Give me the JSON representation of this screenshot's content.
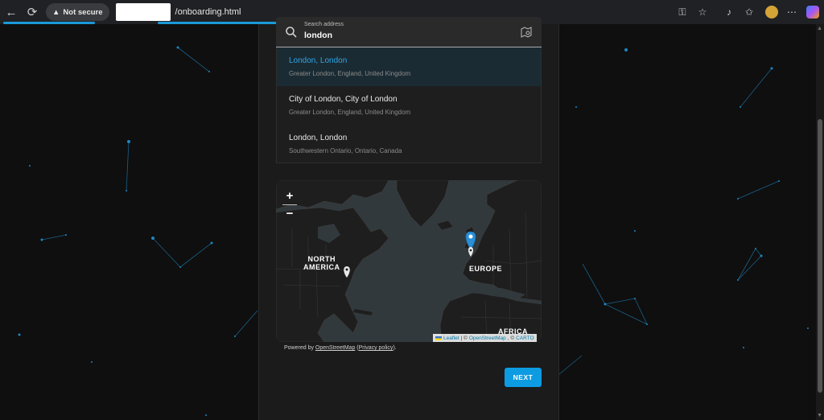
{
  "browser": {
    "security_label": "Not secure",
    "url_path": "/onboarding.html",
    "icons": [
      "back-icon",
      "reload-icon",
      "warning-icon",
      "key-icon",
      "star-icon",
      "extensions-icon",
      "favorites-icon",
      "more-icon"
    ]
  },
  "search": {
    "label": "Search address",
    "value": "london"
  },
  "suggestions": [
    {
      "title": "London, London",
      "subtitle": "Greater London, England, United Kingdom",
      "active": true
    },
    {
      "title": "City of London, City of London",
      "subtitle": "Greater London, England, United Kingdom",
      "active": false
    },
    {
      "title": "London, London",
      "subtitle": "Southwestern Ontario, Ontario, Canada",
      "active": false
    }
  ],
  "map": {
    "zoom_in": "+",
    "zoom_out": "−",
    "labels": {
      "north_america_1": "NORTH",
      "north_america_2": "AMERICA",
      "europe": "EUROPE",
      "africa": "AFRICA"
    },
    "attribution": {
      "leaflet": "Leaflet",
      "sep1": "| ©",
      "osm": "OpenStreetMap",
      "sep2": ", ©",
      "carto": "CARTO"
    },
    "colors": {
      "marker": "#2b8fd6",
      "land": "#1e1e1e",
      "water": "#32393d"
    }
  },
  "powered": {
    "prefix": "Powered by",
    "osm_link": "OpenStreetMap",
    "open_paren": "(",
    "privacy_link": "Privacy policy",
    "close": ")."
  },
  "actions": {
    "next_label": "NEXT"
  },
  "accent_color": "#0d9ce2"
}
